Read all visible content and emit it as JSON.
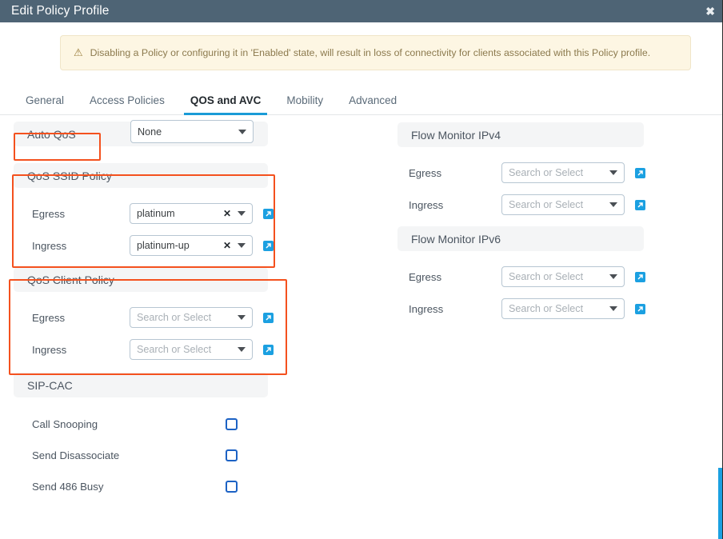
{
  "window": {
    "title": "Edit Policy Profile",
    "close_icon": "close-icon",
    "close_glyph": "✖"
  },
  "banner": {
    "icon": "warning-icon",
    "glyph": "⚠",
    "text": "Disabling a Policy or configuring it in 'Enabled' state, will result in loss of connectivity for clients associated with this Policy profile."
  },
  "tabs": [
    {
      "label": "General",
      "active": false
    },
    {
      "label": "Access Policies",
      "active": false
    },
    {
      "label": "QOS and AVC",
      "active": true
    },
    {
      "label": "Mobility",
      "active": false
    },
    {
      "label": "Advanced",
      "active": false
    }
  ],
  "auto_qos": {
    "label": "Auto QoS",
    "select_value": "None",
    "caret_icon": "chevron-down-icon"
  },
  "qos_ssid_policy": {
    "title": "QoS SSID Policy",
    "rows": [
      {
        "label": "Egress",
        "value": "platinum",
        "placeholder": "Search or Select",
        "has_clear": true,
        "clear_glyph": "✕",
        "link_icon": "external-link-icon"
      },
      {
        "label": "Ingress",
        "value": "platinum-up",
        "placeholder": "Search or Select",
        "has_clear": true,
        "clear_glyph": "✕",
        "link_icon": "external-link-icon"
      }
    ]
  },
  "qos_client_policy": {
    "title": "QoS Client Policy",
    "rows": [
      {
        "label": "Egress",
        "value": "Search or Select",
        "placeholder": "Search or Select",
        "has_clear": false,
        "link_icon": "external-link-icon"
      },
      {
        "label": "Ingress",
        "value": "Search or Select",
        "placeholder": "Search or Select",
        "has_clear": false,
        "link_icon": "external-link-icon"
      }
    ]
  },
  "sip_cac": {
    "title": "SIP-CAC",
    "checkboxes": [
      {
        "label": "Call Snooping",
        "checked": false
      },
      {
        "label": "Send Disassociate",
        "checked": false
      },
      {
        "label": "Send 486 Busy",
        "checked": false
      }
    ]
  },
  "flow_monitor_ipv4": {
    "title": "Flow Monitor IPv4",
    "rows": [
      {
        "label": "Egress",
        "value": "Search or Select",
        "link_icon": "external-link-icon"
      },
      {
        "label": "Ingress",
        "value": "Search or Select",
        "link_icon": "external-link-icon"
      }
    ]
  },
  "flow_monitor_ipv6": {
    "title": "Flow Monitor IPv6",
    "rows": [
      {
        "label": "Egress",
        "value": "Search or Select",
        "link_icon": "external-link-icon"
      },
      {
        "label": "Ingress",
        "value": "Search or Select",
        "link_icon": "external-link-icon"
      }
    ]
  },
  "colors": {
    "titlebar": "#4e6475",
    "accent_blue": "#1a9bd7",
    "annotation_red": "#f4511e",
    "banner_bg": "#fdf6e3",
    "banner_text": "#8c7a4e",
    "checkbox_blue": "#1c62c4"
  }
}
